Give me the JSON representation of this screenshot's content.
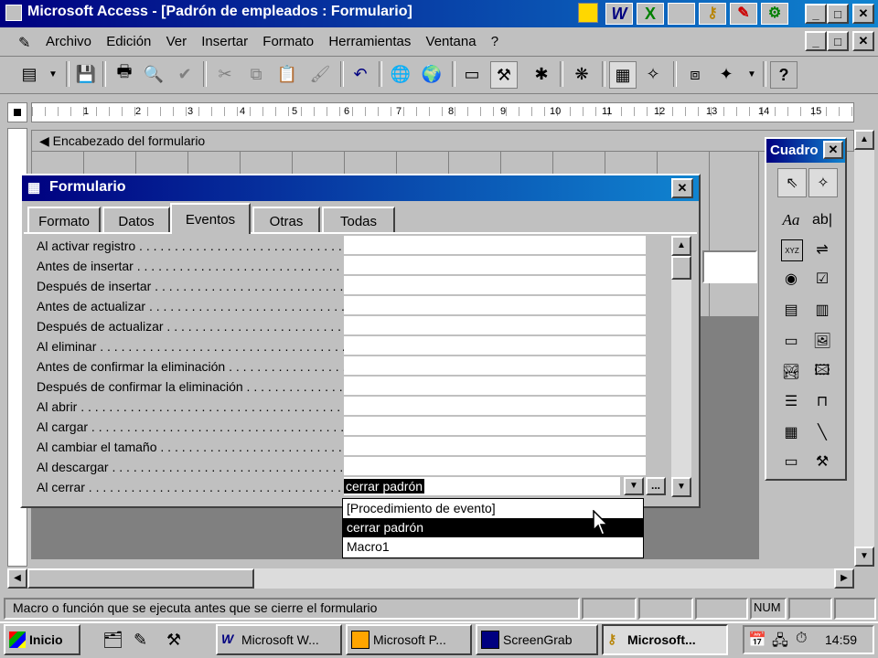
{
  "app": {
    "title": "Microsoft Access - [Padrón de empleados : Formulario]",
    "title_buttons": [
      "_",
      "□",
      "✕"
    ]
  },
  "menu": {
    "items": [
      "Archivo",
      "Edición",
      "Ver",
      "Insertar",
      "Formato",
      "Herramientas",
      "Ventana",
      "?"
    ]
  },
  "ruler": {
    "numbers": [
      "1",
      "2",
      "3",
      "4",
      "5",
      "6",
      "7",
      "8",
      "9",
      "10",
      "11",
      "12",
      "13",
      "14",
      "15"
    ]
  },
  "form_design": {
    "header_section": "Encabezado del formulario"
  },
  "property_sheet": {
    "title": "Formulario",
    "tabs": [
      "Formato",
      "Datos",
      "Eventos",
      "Otras",
      "Todas"
    ],
    "active_tab": "Eventos",
    "properties": [
      {
        "label": "Al activar registro",
        "value": ""
      },
      {
        "label": "Antes de insertar",
        "value": ""
      },
      {
        "label": "Después de insertar",
        "value": ""
      },
      {
        "label": "Antes de actualizar",
        "value": ""
      },
      {
        "label": "Después de actualizar",
        "value": ""
      },
      {
        "label": "Al eliminar",
        "value": ""
      },
      {
        "label": "Antes de confirmar la eliminación",
        "value": ""
      },
      {
        "label": "Después de confirmar la eliminación",
        "value": ""
      },
      {
        "label": "Al abrir",
        "value": ""
      },
      {
        "label": "Al cargar",
        "value": ""
      },
      {
        "label": "Al cambiar el tamaño",
        "value": ""
      },
      {
        "label": "Al descargar",
        "value": ""
      },
      {
        "label": "Al cerrar",
        "value": "cerrar padrón"
      }
    ],
    "dropdown_options": [
      "[Procedimiento de evento]",
      "cerrar padrón",
      "Macro1"
    ],
    "dropdown_selected": "cerrar padrón",
    "builder_button": "..."
  },
  "toolbox": {
    "title": "Cuadro",
    "label_tool": "Aa",
    "textbox_tool": "ab|",
    "group_tool": "XYZ"
  },
  "status_bar": {
    "message": "Macro o función que se ejecuta antes que se cierre el formulario",
    "num": "NUM"
  },
  "taskbar": {
    "start": "Inicio",
    "items": [
      "Microsoft W...",
      "Microsoft P...",
      "ScreenGrab",
      "Microsoft..."
    ],
    "clock": "14:59"
  }
}
